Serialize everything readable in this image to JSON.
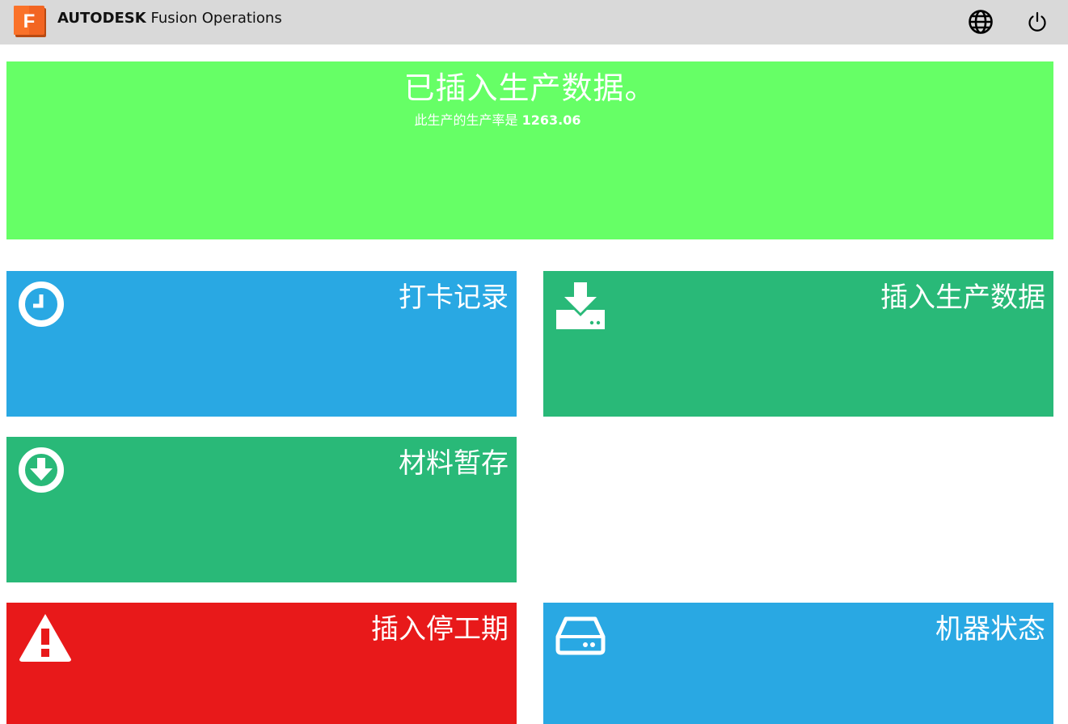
{
  "header": {
    "logo_letter": "F",
    "brand_bold": "AUTODESK",
    "brand_rest": " Fusion Operations",
    "language_icon": "globe-icon",
    "power_icon": "power-icon"
  },
  "banner": {
    "title": "已插入生产数据。",
    "subtitle_prefix": "此生产的生产率是 ",
    "subtitle_value": "1263.06",
    "color": "#66ff66"
  },
  "tiles": [
    {
      "label": "打卡记录",
      "icon": "clock-icon",
      "color": "#29a8e3"
    },
    {
      "label": "插入生产数据",
      "icon": "download-tray-icon",
      "color": "#29b978"
    },
    {
      "label": "材料暂存",
      "icon": "circle-download-icon",
      "color": "#29b978"
    },
    {
      "label": "插入停工期",
      "icon": "warning-icon",
      "color": "#e8191a"
    },
    {
      "label": "机器状态",
      "icon": "hard-drive-icon",
      "color": "#29a8e3"
    }
  ],
  "colors": {
    "topbar": "#d9d9d9",
    "logo_orange": "#f26522"
  }
}
